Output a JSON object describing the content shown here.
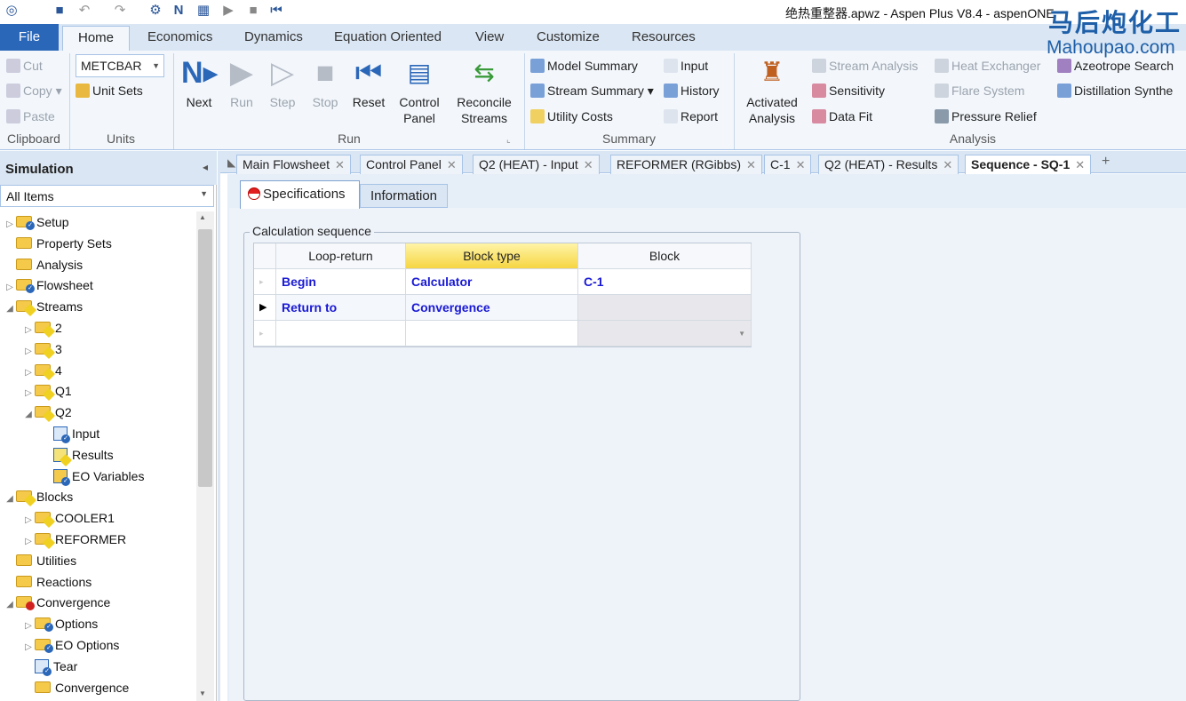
{
  "window": {
    "title": "绝热重整器.apwz - Aspen Plus V8.4 - aspenONE"
  },
  "ribbon_tabs": {
    "file": "File",
    "tabs": [
      "Home",
      "Economics",
      "Dynamics",
      "Equation Oriented",
      "View",
      "Customize",
      "Resources"
    ]
  },
  "clipboard": {
    "cut": "Cut",
    "copy": "Copy",
    "paste": "Paste",
    "group": "Clipboard"
  },
  "units": {
    "selected": "METCBAR",
    "unit_sets": "Unit Sets",
    "group": "Units"
  },
  "run": {
    "next": "Next",
    "run": "Run",
    "step": "Step",
    "stop": "Stop",
    "reset": "Reset",
    "control_panel_1": "Control",
    "control_panel_2": "Panel",
    "reconcile_1": "Reconcile",
    "reconcile_2": "Streams",
    "group": "Run"
  },
  "summary": {
    "model_summary": "Model Summary",
    "stream_summary": "Stream Summary",
    "utility_costs": "Utility Costs",
    "input": "Input",
    "history": "History",
    "report": "Report",
    "group": "Summary"
  },
  "analysis": {
    "activated_1": "Activated",
    "activated_2": "Analysis",
    "stream_analysis": "Stream Analysis",
    "sensitivity": "Sensitivity",
    "data_fit": "Data Fit",
    "heat_exchanger": "Heat Exchanger",
    "flare_system": "Flare System",
    "pressure_relief": "Pressure Relief",
    "azeotrope": "Azeotrope Search",
    "distillation": "Distillation Synthe",
    "group": "Analysis"
  },
  "watermark": {
    "cn": "马后炮化工",
    "en": "Mahoupao.com"
  },
  "nav": {
    "title": "Simulation",
    "filter": "All Items",
    "items": [
      {
        "label": "Setup",
        "indent": 0,
        "expander": "▷",
        "icon": "folder-check"
      },
      {
        "label": "Property Sets",
        "indent": 0,
        "expander": "",
        "icon": "folder"
      },
      {
        "label": "Analysis",
        "indent": 0,
        "expander": "",
        "icon": "folder"
      },
      {
        "label": "Flowsheet",
        "indent": 0,
        "expander": "▷",
        "icon": "folder-check"
      },
      {
        "label": "Streams",
        "indent": 0,
        "expander": "◢",
        "icon": "folder-diamond"
      },
      {
        "label": "2",
        "indent": 1,
        "expander": "▷",
        "icon": "folder-diamond"
      },
      {
        "label": "3",
        "indent": 1,
        "expander": "▷",
        "icon": "folder-diamond"
      },
      {
        "label": "4",
        "indent": 1,
        "expander": "▷",
        "icon": "folder-diamond"
      },
      {
        "label": "Q1",
        "indent": 1,
        "expander": "▷",
        "icon": "folder-diamond"
      },
      {
        "label": "Q2",
        "indent": 1,
        "expander": "◢",
        "icon": "folder-diamond"
      },
      {
        "label": "Input",
        "indent": 2,
        "expander": "",
        "icon": "form-check"
      },
      {
        "label": "Results",
        "indent": 2,
        "expander": "",
        "icon": "form-diamond"
      },
      {
        "label": "EO Variables",
        "indent": 2,
        "expander": "",
        "icon": "form-check-yellow"
      },
      {
        "label": "Blocks",
        "indent": 0,
        "expander": "◢",
        "icon": "folder-diamond"
      },
      {
        "label": "COOLER1",
        "indent": 1,
        "expander": "▷",
        "icon": "folder-diamond"
      },
      {
        "label": "REFORMER",
        "indent": 1,
        "expander": "▷",
        "icon": "folder-diamond"
      },
      {
        "label": "Utilities",
        "indent": 0,
        "expander": "",
        "icon": "folder"
      },
      {
        "label": "Reactions",
        "indent": 0,
        "expander": "",
        "icon": "folder"
      },
      {
        "label": "Convergence",
        "indent": 0,
        "expander": "◢",
        "icon": "folder-red"
      },
      {
        "label": "Options",
        "indent": 1,
        "expander": "▷",
        "icon": "folder-check"
      },
      {
        "label": "EO Options",
        "indent": 1,
        "expander": "▷",
        "icon": "folder-check"
      },
      {
        "label": "Tear",
        "indent": 1,
        "expander": "",
        "icon": "form-check"
      },
      {
        "label": "Convergence",
        "indent": 1,
        "expander": "",
        "icon": "folder"
      }
    ]
  },
  "doc_tabs": [
    "Main Flowsheet",
    "Control Panel",
    "Q2 (HEAT) - Input",
    "REFORMER (RGibbs)",
    "C-1",
    "Q2 (HEAT) - Results",
    "Sequence - SQ-1"
  ],
  "sub_tabs": {
    "specifications": "Specifications",
    "information": "Information"
  },
  "sequence": {
    "group_title": "Calculation sequence",
    "columns": [
      "Loop-return",
      "Block type",
      "Block"
    ],
    "rows": [
      {
        "loop": "Begin",
        "type": "Calculator",
        "block": "C-1"
      },
      {
        "loop": "Return to",
        "type": "Convergence",
        "block": ""
      },
      {
        "loop": "",
        "type": "",
        "block": ""
      }
    ]
  },
  "colors": {
    "accent": "#2b67b8",
    "value_text": "#1a1ad4",
    "selected_header": "#f6d542"
  }
}
